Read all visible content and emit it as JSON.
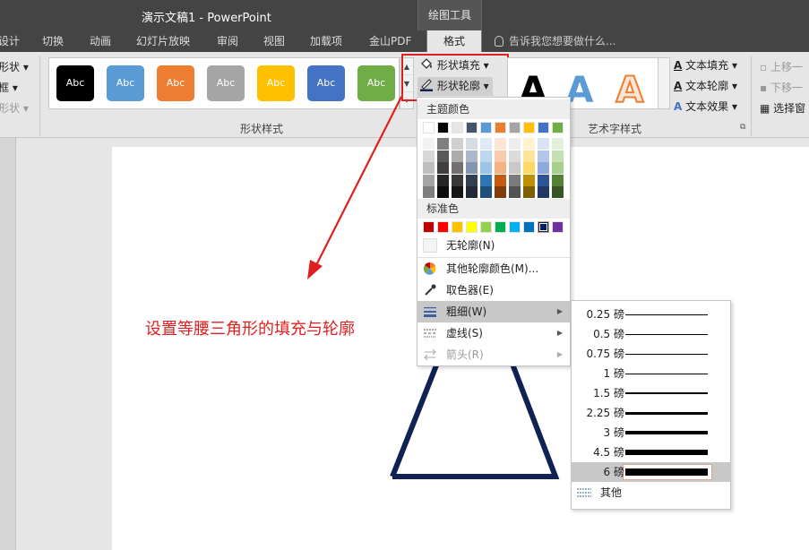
{
  "window": {
    "title": "演示文稿1 - PowerPoint",
    "context_tab_group": "绘图工具"
  },
  "tabs": [
    {
      "label": "设计",
      "partial": true
    },
    {
      "label": "切换"
    },
    {
      "label": "动画"
    },
    {
      "label": "幻灯片放映"
    },
    {
      "label": "审阅"
    },
    {
      "label": "视图"
    },
    {
      "label": "加载项"
    },
    {
      "label": "金山PDF"
    },
    {
      "label": "格式",
      "active": true
    }
  ],
  "tell_me": "告诉我您想要做什么...",
  "ribbon": {
    "left_cut_items": [
      "形状 ▾",
      "框 ▾",
      "形状 ▾"
    ],
    "shape_styles": {
      "label": "形状样式",
      "swatch_text": "Abc",
      "swatch_colors": [
        "#000000",
        "#5b9bd5",
        "#ed7d31",
        "#a5a5a5",
        "#ffc000",
        "#4472c4",
        "#70ad47"
      ]
    },
    "shape_fill": "形状填充 ▾",
    "shape_outline": "形状轮廓 ▾",
    "wordart": {
      "label": "艺术字样式",
      "glyph": "A",
      "text_fill": "文本填充 ▾",
      "text_outline": "文本轮廓 ▾",
      "text_effects": "文本效果 ▾"
    },
    "arrange": {
      "bring_forward": "上移一",
      "send_backward": "下移一",
      "selection_pane": "选择窗"
    }
  },
  "menu": {
    "theme_colors_header": "主题颜色",
    "theme_colors_top": [
      "#ffffff",
      "#000000",
      "#e7e6e6",
      "#44546a",
      "#5b9bd5",
      "#ed7d31",
      "#a5a5a5",
      "#ffc000",
      "#4472c4",
      "#70ad47"
    ],
    "theme_shades": [
      [
        "#f2f2f2",
        "#7f7f7f",
        "#d0cece",
        "#d6dce4",
        "#deebf6",
        "#fbe5d5",
        "#ededed",
        "#fff2cc",
        "#dae3f3",
        "#e2efd9"
      ],
      [
        "#d8d8d8",
        "#595959",
        "#aeabab",
        "#adb9ca",
        "#bdd7ee",
        "#f7cbac",
        "#dbdbdb",
        "#fee599",
        "#b4c6e7",
        "#c5e0b3"
      ],
      [
        "#bfbfbf",
        "#3f3f3f",
        "#757070",
        "#8496b0",
        "#9dc3e6",
        "#f4b183",
        "#c9c9c9",
        "#ffd965",
        "#8eaadb",
        "#a8d08d"
      ],
      [
        "#a5a5a5",
        "#262626",
        "#3a3838",
        "#323f4f",
        "#2e75b5",
        "#c55a11",
        "#7b7b7b",
        "#bf9000",
        "#2f5496",
        "#538135"
      ],
      [
        "#7f7f7f",
        "#0c0c0c",
        "#171616",
        "#222a35",
        "#1e4e79",
        "#833c0b",
        "#525252",
        "#7f6000",
        "#1f3864",
        "#375623"
      ]
    ],
    "standard_header": "标准色",
    "standard_colors": [
      "#c00000",
      "#ff0000",
      "#ffc000",
      "#ffff00",
      "#92d050",
      "#00b050",
      "#00b0f0",
      "#0070c0",
      "#002060",
      "#7030a0"
    ],
    "no_outline": "无轮廓(N)",
    "more_colors": "其他轮廓颜色(M)...",
    "eyedropper": "取色器(E)",
    "weight": "粗细(W)",
    "dashes": "虚线(S)",
    "arrows": "箭头(R)"
  },
  "weights": [
    {
      "label": "0.25 磅",
      "pt": 0.25
    },
    {
      "label": "0.5 磅",
      "pt": 0.5
    },
    {
      "label": "0.75 磅",
      "pt": 0.75
    },
    {
      "label": "1 磅",
      "pt": 1
    },
    {
      "label": "1.5 磅",
      "pt": 1.5
    },
    {
      "label": "2.25 磅",
      "pt": 2.25
    },
    {
      "label": "3 磅",
      "pt": 3
    },
    {
      "label": "4.5 磅",
      "pt": 4.5
    },
    {
      "label": "6 磅",
      "pt": 6,
      "selected": true
    }
  ],
  "weights_more": "其他",
  "slide": {
    "caption": "设置等腰三角形的填充与轮廓",
    "triangle_outline_color": "#0f2252"
  }
}
